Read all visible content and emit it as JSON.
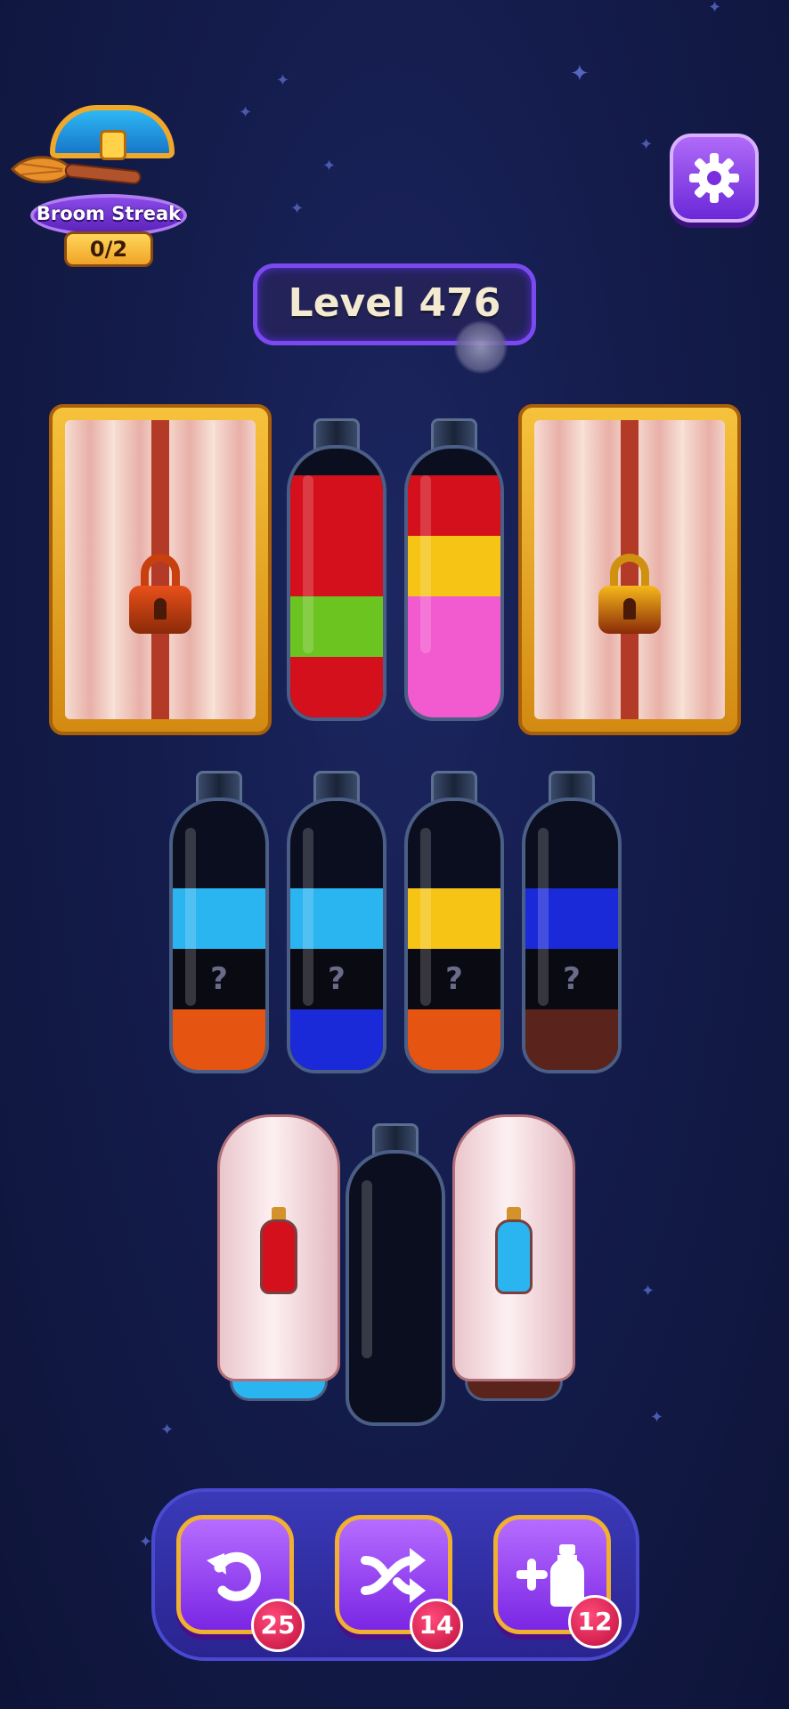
{
  "streak": {
    "label": "Broom Streak",
    "count": "0/2"
  },
  "level": {
    "label": "Level 476"
  },
  "colors": {
    "red": "#d4101c",
    "green": "#6cc420",
    "yellow": "#f6c415",
    "pink": "#f25ad0",
    "lightblue": "#2ab4f0",
    "black": "#0a0a12",
    "orange": "#e65412",
    "blue": "#1a2ad8",
    "brown": "#5a241c"
  },
  "row1": [
    {
      "type": "locked",
      "lock_color": "#e8501a"
    },
    {
      "type": "bottle",
      "layers": [
        "red",
        "green",
        "red",
        "red"
      ]
    },
    {
      "type": "bottle",
      "layers": [
        "pink",
        "pink",
        "yellow",
        "red"
      ]
    },
    {
      "type": "locked",
      "lock_color": "#f6b81a"
    }
  ],
  "row2": [
    {
      "type": "bottle",
      "layers": [
        "orange",
        "black",
        "lightblue"
      ],
      "hidden_index": 1
    },
    {
      "type": "bottle",
      "layers": [
        "blue",
        "black",
        "lightblue"
      ],
      "hidden_index": 1
    },
    {
      "type": "bottle",
      "layers": [
        "orange",
        "black",
        "yellow"
      ],
      "hidden_index": 1
    },
    {
      "type": "bottle",
      "layers": [
        "brown",
        "black",
        "blue"
      ],
      "hidden_index": 1
    }
  ],
  "row2_hidden_mark": "?",
  "row3": [
    {
      "type": "covered",
      "hint_color": "red",
      "base_color": "lightblue"
    },
    {
      "type": "bottle",
      "layers": []
    },
    {
      "type": "covered",
      "hint_color": "lightblue",
      "base_color": "brown"
    }
  ],
  "tools": {
    "undo": {
      "icon": "undo-icon",
      "count": "25"
    },
    "shuffle": {
      "icon": "shuffle-icon",
      "count": "14"
    },
    "add_bottle": {
      "icon": "add-bottle-icon",
      "count": "12"
    }
  }
}
